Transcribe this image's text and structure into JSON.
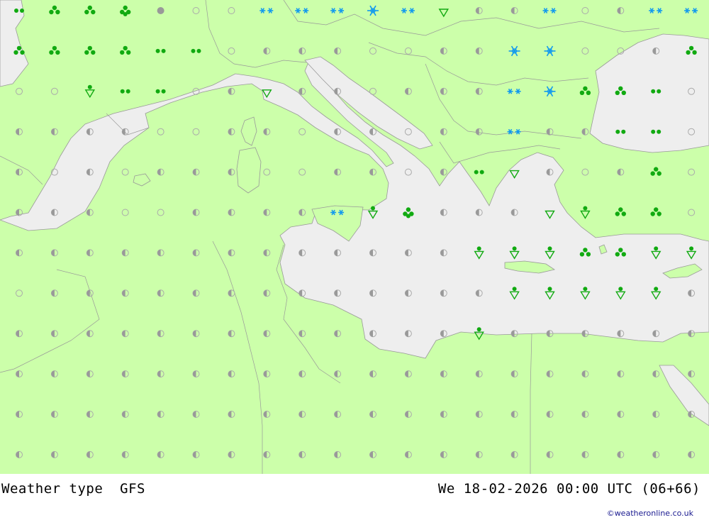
{
  "header": {
    "left_title": "Weather type  GFS",
    "right_title": "We 18-02-2026 00:00 UTC (06+66)"
  },
  "credit": "©weatheronline.co.uk",
  "colors": {
    "land": "#ccffaa",
    "sea": "#eeeeee",
    "border": "#999999",
    "rain": "#11aa11",
    "snow": "#1199ee",
    "cloud": "#999999",
    "clear_ring": "#aaaaaa",
    "thunder": "#ee2222"
  },
  "legend_icons": {
    "clear": "clear-circle-icon",
    "partly_cloudy": "half-cloud-icon",
    "overcast": "overcast-dot-icon",
    "drizzle": "drizzle-dots-icon",
    "rain": "rain-cluster-icon",
    "shower": "shower-triangle-icon",
    "light_snow": "snow-stars-icon",
    "heavy_snow": "snowflake-icon",
    "mix": "sleet-symbol-icon"
  },
  "grid": {
    "columns": 20,
    "rows": 12,
    "codes": [
      "drDR.ooSSSFSphhSohSSt",
      "DDDDddohhhoohhFFoohDd",
      "oosddohphhohhhSFDDdo",
      "hhhhoohhohhohhShhddo",
      "hohohhhoohhohdphohDo",
      "hhhoohhhhSsRhhhpsDDo",
      "hhhhhhhhhhhhhsssDDss",
      "ohhhhhhhhhhhhhsssssh",
      "hhhhhhhhhhhhhshhhhhh",
      "hhhhhhhhhhhhhhhhhhhh",
      "hhhhhhhhhhhhhhhhhhhh",
      "hhhhhhhhhhhhhhhhhhhh"
    ]
  }
}
